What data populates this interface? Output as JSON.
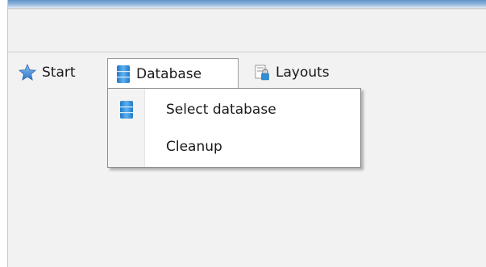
{
  "tabs": {
    "start_label": "Start",
    "database_label": "Database",
    "layouts_label": "Layouts"
  },
  "database_menu": {
    "items": [
      {
        "label": "Select database",
        "icon": "database-icon"
      },
      {
        "label": "Cleanup",
        "icon": ""
      }
    ]
  },
  "colors": {
    "titlebar": "#5f93c8",
    "window_bg": "#f2f2f2",
    "menu_bg": "#ffffff",
    "database_icon": "#2f8fd6",
    "star_icon": "#3f86d6"
  }
}
